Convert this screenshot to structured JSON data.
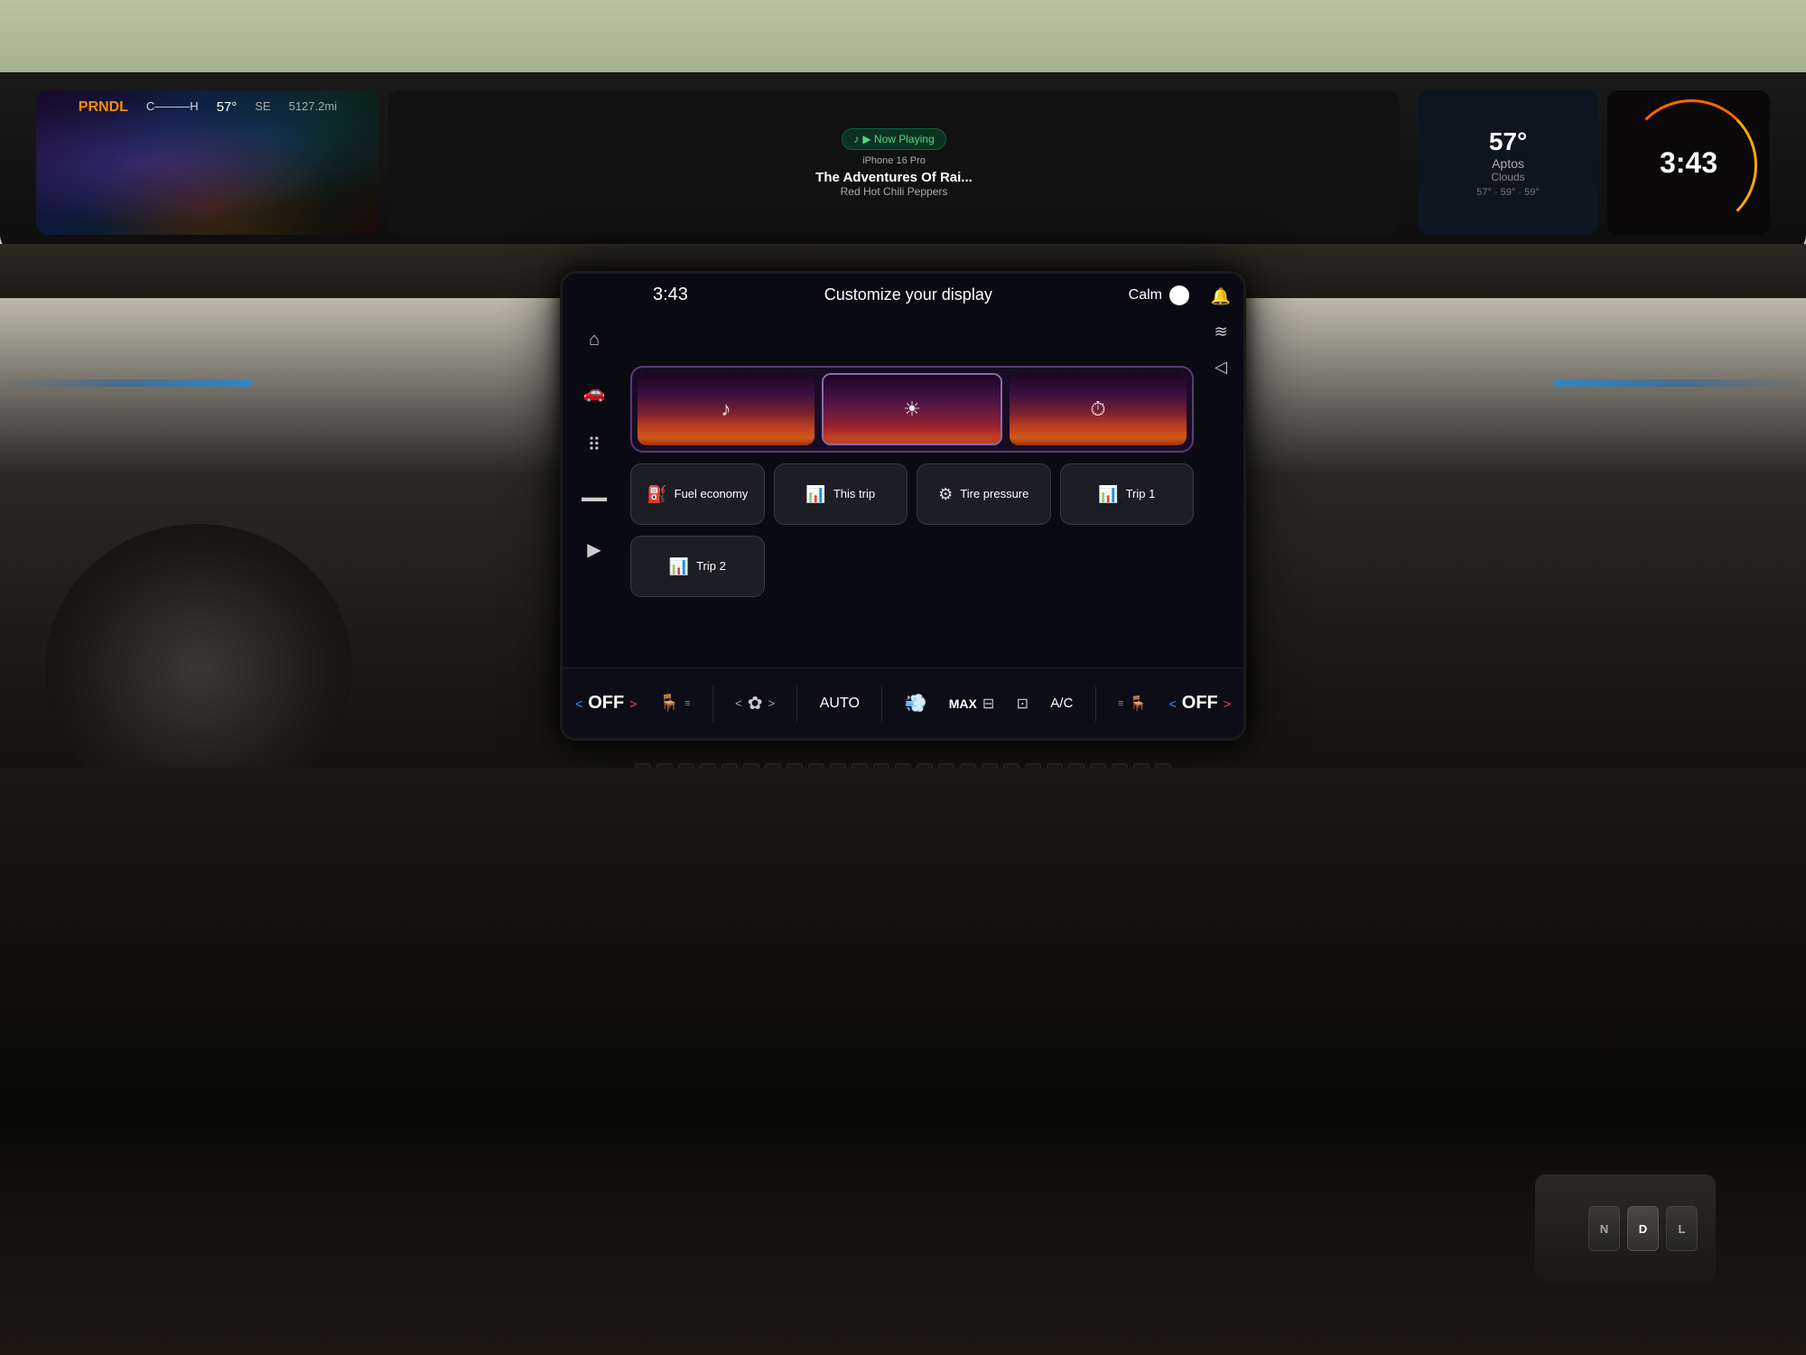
{
  "car": {
    "background_color": "#2a2822"
  },
  "instrument_cluster": {
    "prndl": "PRNDL",
    "gear": "D",
    "temp_indicator": "C———H",
    "temperature": "57°",
    "direction": "SE",
    "odometer": "5127.2mi",
    "clock": "3:43",
    "now_playing_badge": "▶ Now Playing",
    "song_title": "The Adventures Of Rai...",
    "song_artist": "Red Hot Chili Peppers",
    "iphone_label": "iPhone 16 Pro",
    "weather_temp": "57°",
    "weather_location": "Aptos",
    "weather_desc": "Clouds",
    "weather_low": "57°",
    "weather_mid": "59°",
    "weather_high": "59°"
  },
  "screen": {
    "time": "3:43",
    "title": "Customize your display",
    "calm_label": "Calm",
    "tiles": [
      {
        "icon": "♪",
        "label": "music"
      },
      {
        "icon": "☀",
        "label": "weather"
      },
      {
        "icon": "⏰",
        "label": "clock"
      }
    ],
    "widgets": [
      {
        "icon": "⛽",
        "label": "Fuel economy",
        "id": "fuel-economy"
      },
      {
        "icon": "📊",
        "label": "This trip",
        "id": "this-trip"
      },
      {
        "icon": "⚙",
        "label": "Tire pressure",
        "id": "tire-pressure"
      },
      {
        "icon": "📊",
        "label": "Trip 1",
        "id": "trip-1"
      }
    ],
    "widgets_row2": [
      {
        "icon": "📊",
        "label": "Trip 2",
        "id": "trip-2"
      }
    ],
    "nav_icons": [
      {
        "icon": "🏠",
        "label": "home"
      },
      {
        "icon": "🚗",
        "label": "vehicle"
      },
      {
        "icon": "⠿",
        "label": "apps"
      },
      {
        "icon": "▬▬",
        "label": "media-bar"
      },
      {
        "icon": "▶",
        "label": "play"
      }
    ],
    "right_nav_icons": [
      {
        "icon": "🔔",
        "label": "notifications"
      },
      {
        "icon": "≋",
        "label": "settings"
      },
      {
        "icon": "◀",
        "label": "back"
      }
    ]
  },
  "hvac": {
    "left_off": "OFF",
    "left_arrow_left": "<",
    "left_arrow_right": ">",
    "fan_left": "<",
    "fan_label": "AUTO",
    "fan_right": ">",
    "defrost_front": "MAX",
    "defrost_rear_icon": "⊟",
    "ac_label": "A/C",
    "right_seat_icon": "≡L",
    "right_off": "OFF",
    "right_arrow_left": "<",
    "right_arrow_right": ">"
  },
  "gear_keys": [
    "N",
    "D",
    "L"
  ],
  "colors": {
    "screen_bg": "#0a0a12",
    "accent_blue": "#3399ff",
    "accent_red": "#ff4444",
    "tile_border": "#5a3a7a",
    "widget_bg": "rgba(255,255,255,0.08)"
  }
}
